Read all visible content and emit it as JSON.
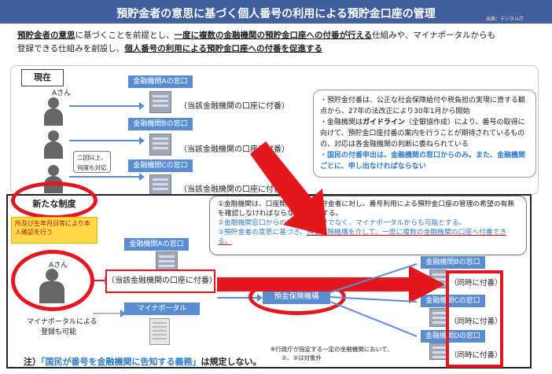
{
  "header": {
    "title": "預貯金者の意思に基づく個人番号の利用による預貯金口座の管理",
    "source": "出典：デジタル庁"
  },
  "intro": {
    "part1": "預貯金者の意思",
    "part2": "に基づくことを前提とし、",
    "part3": "一度に複数の金融機関の預貯金口座への付番が行える",
    "part4": "仕組みや、マイナポータルからも",
    "part5": "登録できる仕組みを創設し、",
    "part6": "個人番号の利用による預貯金口座への付番を促進する"
  },
  "current": {
    "label": "現在",
    "person_name": "Aさん",
    "banks": [
      "金融機関Aの窓口",
      "金融機関Bの窓口",
      "金融機関Cの窓口"
    ],
    "attach_note": "（当該金融機関の口座に付番）",
    "twice_note_line1": "二回以上、",
    "twice_note_line2": "何度も対応",
    "info": {
      "line1": "・預貯金付番は、公正な社会保障給付や税負担の実現に資する観点から、27年の法改正により30年1月から開始",
      "line2a": "・金融機関は",
      "line2b": "ガイドライン",
      "line2c": "（全銀協作成）により、番号の取得に向けて、預貯金口座付番の案内を行うことが期待されているものの、対応は各金融機関の判断に委ねられている",
      "line3": "・国民の付番申出は、金融機関の窓口からのみ。また、金融機関ごとに、申し出なければならない"
    }
  },
  "new_system": {
    "label": "新たな制度",
    "callout": "所及び生年月日等により本人確認を行う",
    "points": {
      "p1": "①金融機関は、口座開設時等に預貯金者に対し、番号利用による預貯金口座の管理の希望の有無を確認しなければならないと規定する。",
      "p2": "②金融機関窓口からの番号付番だけでなく、マイナポータルからも可能とする。",
      "p3a": "③預貯金者の意思に基づき、",
      "p3b": "預金保険機構を介して、一度に複数の金融機関の口座へ付番できる。"
    },
    "person_name": "Aさん",
    "bank_a": "金融機関Aの窓口",
    "attach_label": "（当該金融機関の口座に付番）",
    "portal": "マイナポータル",
    "portal_note_line1": "マイナポータルによる",
    "portal_note_line2": "登録も可能",
    "dic": "預金保険機構",
    "banks_right": [
      "金融機関Bの窓口",
      "金融機関Cの窓口",
      "金融機関Dの窓口"
    ],
    "simultaneous": "（同時に付番）",
    "small_note_line1": "※行政庁が指定する一定の金融機関において、",
    "small_note_line2": "②、③は対象外"
  },
  "footer": {
    "prefix": "注）",
    "quote": "「国民が番号を金融機関に告知する義務」",
    "suffix": "は規定しない。"
  },
  "colors": {
    "header_bg": "#3f5f9f",
    "bank_blue": "#5a8cd4",
    "accent_red": "#e3171d",
    "info_blue": "#2f7bc9",
    "callout_yellow": "#ffd84a"
  }
}
